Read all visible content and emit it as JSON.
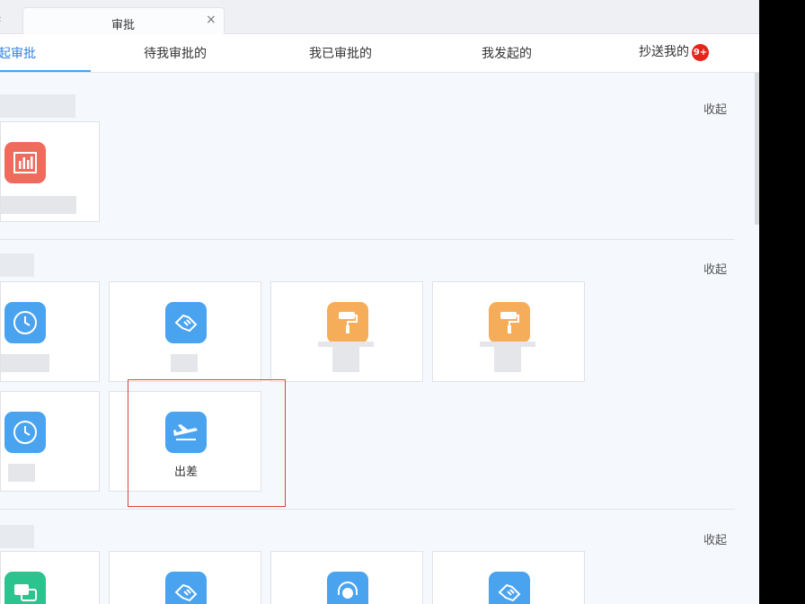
{
  "tab": {
    "title": "审批",
    "close_icon": "×",
    "prev_icon": "‹"
  },
  "nav": {
    "items": [
      {
        "label": "起审批"
      },
      {
        "label": "待我审批的"
      },
      {
        "label": "我已审批的"
      },
      {
        "label": "我发起的"
      },
      {
        "label": "抄送我的"
      }
    ],
    "badge": "9+"
  },
  "sections": [
    {
      "collapse_label": "收起"
    },
    {
      "collapse_label": "收起"
    },
    {
      "collapse_label": "收起"
    }
  ],
  "cards": {
    "trip_label": "出差"
  },
  "colors": {
    "accent": "#2b7fe0",
    "blue_icon": "#4aa3ef",
    "orange_icon": "#f6ad5a",
    "red_icon": "#ef6b5c",
    "green_icon": "#2cc38f",
    "highlight": "#d9453d"
  }
}
